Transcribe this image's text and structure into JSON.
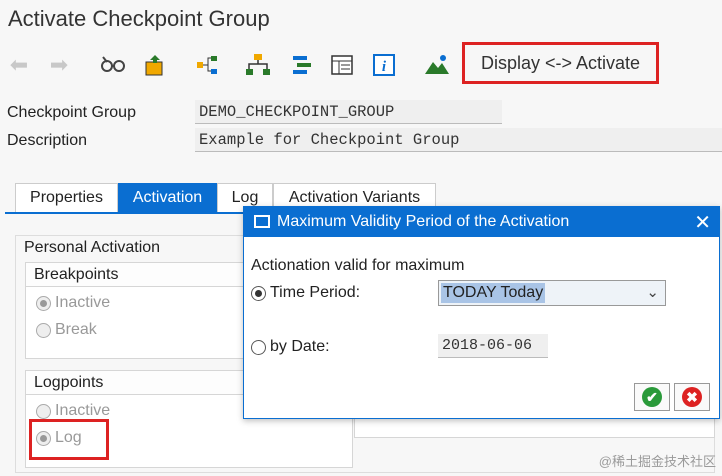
{
  "window_title": "Activate Checkpoint Group",
  "toolbar": {
    "display_activate": "Display <-> Activate",
    "icons": [
      "back-arrow-icon",
      "forward-arrow-icon",
      "glasses-icon",
      "transport-icon",
      "hierarchy-icon",
      "tree-icon",
      "list-icon",
      "table-icon",
      "info-icon",
      "mountain-icon"
    ]
  },
  "header": {
    "checkpoint_group_label": "Checkpoint Group",
    "checkpoint_group_value": "DEMO_CHECKPOINT_GROUP",
    "description_label": "Description",
    "description_value": "Example for Checkpoint Group"
  },
  "tabs": [
    {
      "label": "Properties",
      "active": false
    },
    {
      "label": "Activation",
      "active": true
    },
    {
      "label": "Log",
      "active": false
    },
    {
      "label": "Activation Variants",
      "active": false
    }
  ],
  "personal_activation": {
    "title": "Personal Activation",
    "breakpoints": {
      "title": "Breakpoints",
      "options": [
        "Inactive",
        "Break"
      ],
      "selected": "Inactive"
    },
    "logpoints": {
      "title": "Logpoints",
      "options": [
        "Inactive",
        "Log"
      ],
      "selected": "Log"
    }
  },
  "dialog": {
    "title": "Maximum Validity Period of the Activation",
    "heading": "Actionation valid for maximum",
    "time_period_label": "Time Period:",
    "time_period_value": "TODAY Today",
    "by_date_label": "by Date:",
    "date_value": "2018-06-06",
    "selected": "time_period"
  },
  "watermark": "@稀土掘金技术社区",
  "colors": {
    "accent": "#0a6ed1",
    "highlight": "#d22222"
  }
}
